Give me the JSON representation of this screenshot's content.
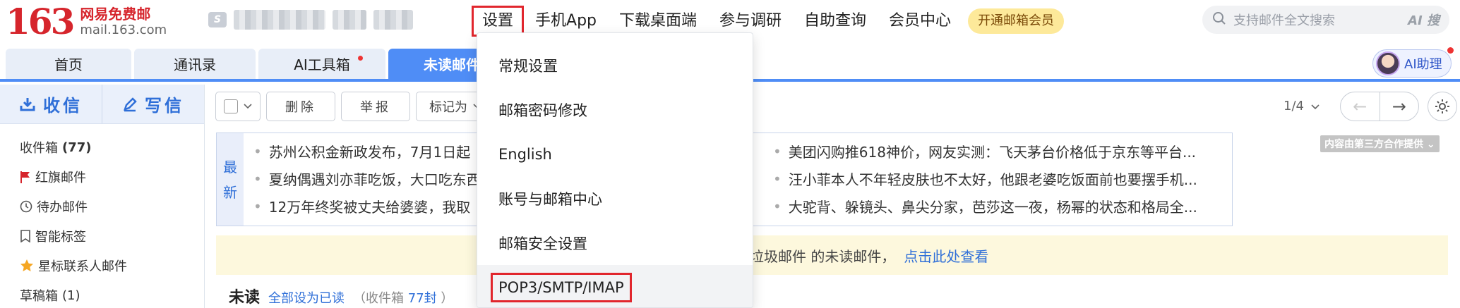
{
  "logo": {
    "number": "163",
    "cn": "网易免费邮",
    "en": "mail.163.com"
  },
  "account": {
    "badge": "S"
  },
  "nav": {
    "items": [
      "设置",
      "手机App",
      "下载桌面端",
      "参与调研",
      "自助查询",
      "会员中心"
    ],
    "vip": "开通邮箱会员"
  },
  "search": {
    "placeholder": "支持邮件全文搜索",
    "ai_label": "AI 搜"
  },
  "tabs": [
    "首页",
    "通讯录",
    "AI工具箱",
    "未读邮件"
  ],
  "ai_helper": {
    "label": "AI助理"
  },
  "sidebar": {
    "receive": "收信",
    "write": "写信",
    "items": [
      {
        "label": "收件箱",
        "count": "(77)"
      },
      {
        "label": "红旗邮件"
      },
      {
        "label": "待办邮件"
      },
      {
        "label": "智能标签"
      },
      {
        "label": "星标联系人邮件"
      },
      {
        "label": "草稿箱",
        "count": "(1)"
      }
    ]
  },
  "toolbar": {
    "delete": "删除",
    "report": "举报",
    "mark_as": "标记为"
  },
  "pager": {
    "page": "1/4"
  },
  "news": {
    "side_label_1": "最",
    "side_label_2": "新",
    "left": [
      "苏州公积金新政发布，7月1日起",
      "夏纳偶遇刘亦菲吃饭，大口吃东西",
      "12万年终奖被丈夫给婆婆，我取"
    ],
    "right": [
      "美团闪购推618神价，网友实测：飞天茅台价格低于京东等平台...",
      "汪小菲本人不年轻皮肤也不太好，他跟老婆吃饭面前也要摆手机...",
      "大驼背、躲镜头、鼻尖分家，芭莎这一夜，杨幂的状态和格局全..."
    ],
    "third_party": "内容由第三方合作提供"
  },
  "notice": {
    "text": "，垃圾邮件 的未读邮件，",
    "link": "点击此处查看"
  },
  "unread": {
    "title": "未读",
    "mark_all": "全部设为已读",
    "inbox_prefix": "（收件箱",
    "inbox_count": "77封",
    "inbox_suffix": "）"
  },
  "dropdown": {
    "items": [
      "常规设置",
      "邮箱密码修改",
      "English",
      "账号与邮箱中心",
      "邮箱安全设置",
      "POP3/SMTP/IMAP"
    ],
    "highlighted": "POP3/SMTP/IMAP"
  },
  "colors": {
    "brand_red": "#d6252c",
    "accent_blue": "#4f8df6",
    "highlight_red": "#e1262d"
  }
}
